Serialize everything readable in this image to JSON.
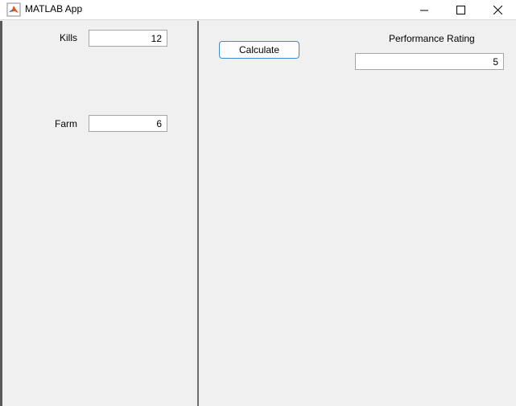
{
  "window": {
    "title": "MATLAB App",
    "icons": {
      "app": "matlab-logo-icon",
      "minimize": "minimize-icon",
      "maximize": "maximize-icon",
      "close": "close-icon"
    },
    "colors": {
      "background": "#f0f0f0",
      "button_border": "#3d8ad6",
      "divider": "#6d6d6d"
    }
  },
  "left_panel": {
    "kills": {
      "label": "Kills",
      "value": "12"
    },
    "farm": {
      "label": "Farm",
      "value": "6"
    }
  },
  "right_panel": {
    "calculate_label": "Calculate",
    "performance": {
      "label": "Performance Rating",
      "value": "5"
    }
  }
}
